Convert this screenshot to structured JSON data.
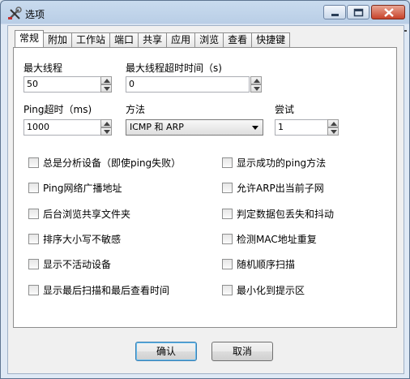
{
  "window": {
    "title": "选项"
  },
  "tabs": [
    "常规",
    "附加",
    "工作站",
    "端口",
    "共享",
    "应用",
    "浏览",
    "查看",
    "快捷键"
  ],
  "active_tab": "常规",
  "fields": {
    "max_threads": {
      "label": "最大线程",
      "value": "50"
    },
    "thread_timeout": {
      "label": "最大线程超时时间（s)",
      "value": "0"
    },
    "ping_timeout": {
      "label": "Ping超时（ms)",
      "value": "1000"
    },
    "method": {
      "label": "方法",
      "value": "ICMP 和 ARP"
    },
    "retries": {
      "label": "尝试",
      "value": "1"
    }
  },
  "checkboxes_left": [
    "总是分析设备（即使ping失败）",
    "Ping网络广播地址",
    "后台浏览共享文件夹",
    "排序大小写不敏感",
    "显示不活动设备",
    "显示最后扫描和最后查看时间"
  ],
  "checkboxes_right": [
    "显示成功的ping方法",
    "允许ARP出当前子网",
    "判定数据包丢失和抖动",
    "检测MAC地址重复",
    "随机顺序扫描",
    "最小化到提示区"
  ],
  "buttons": {
    "ok": "确认",
    "cancel": "取消"
  },
  "icons": [
    "tools-icon",
    "minimize-icon",
    "maximize-icon",
    "close-icon",
    "pin-arrow-icon"
  ]
}
